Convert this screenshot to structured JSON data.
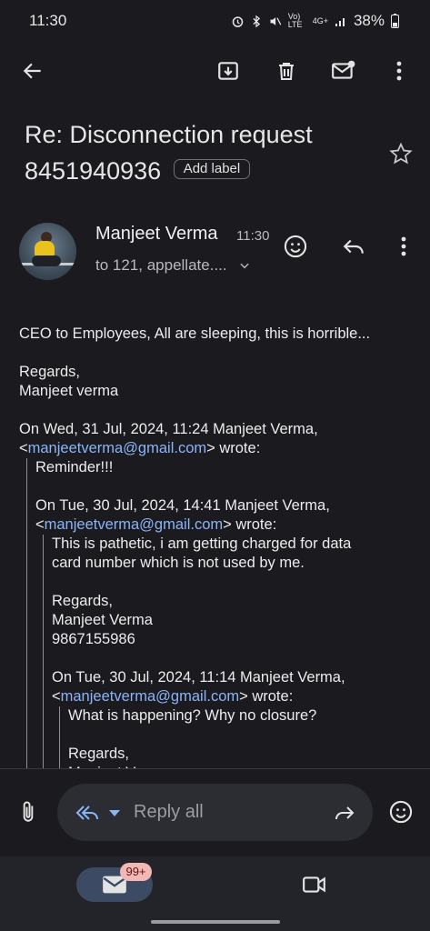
{
  "status": {
    "time": "11:30",
    "network": "Vo) LTE",
    "signal": "4G+",
    "battery": "38%"
  },
  "toolbar": {
    "back": "arrow-back-icon",
    "archive": "archive-icon",
    "delete": "delete-icon",
    "mark_unread": "mark-unread-icon",
    "more": "more-vert-icon"
  },
  "email": {
    "subject_line1": "Re: Disconnection request",
    "subject_line2": "8451940936",
    "add_label": "Add label",
    "sender": "Manjeet Verma",
    "time": "11:30",
    "recipients": "to 121, appellate....",
    "body": {
      "line1": "CEO to Employees,  All are sleeping,  this is horrible...",
      "regards1": "Regards,",
      "sign1": "Manjeet verma",
      "q1_header": "On Wed, 31 Jul, 2024, 11:24 Manjeet Verma,",
      "q1_email": "manjeetverma@gmail.com",
      "q1_wrote": "> wrote:",
      "q1_text": "Reminder!!!",
      "q2_header": "On Tue, 30 Jul, 2024, 14:41 Manjeet Verma,",
      "q2_email": "manjeetverma@gmail.com",
      "q2_wrote": "> wrote:",
      "q2_text1": "This is pathetic,  i am getting charged for data",
      "q2_text2": "card number which is not used by me.",
      "q2_regards": "Regards,",
      "q2_sign": "Manjeet Verma",
      "q2_phone": "9867155986",
      "q3_header": "On Tue, 30 Jul, 2024, 11:14 Manjeet Verma,",
      "q3_email": "manjeetverma@gmail.com",
      "q3_wrote": "> wrote:",
      "q3_text": "What is happening? Why no closure?",
      "q3_regards": "Regards,",
      "q3_sign": "Manjeet V..."
    }
  },
  "reply": {
    "placeholder": "Reply all"
  },
  "nav": {
    "badge": "99+"
  },
  "colors": {
    "background": "#1b1b1f",
    "link": "#8ab4f8",
    "badge": "#f2b8b5"
  }
}
